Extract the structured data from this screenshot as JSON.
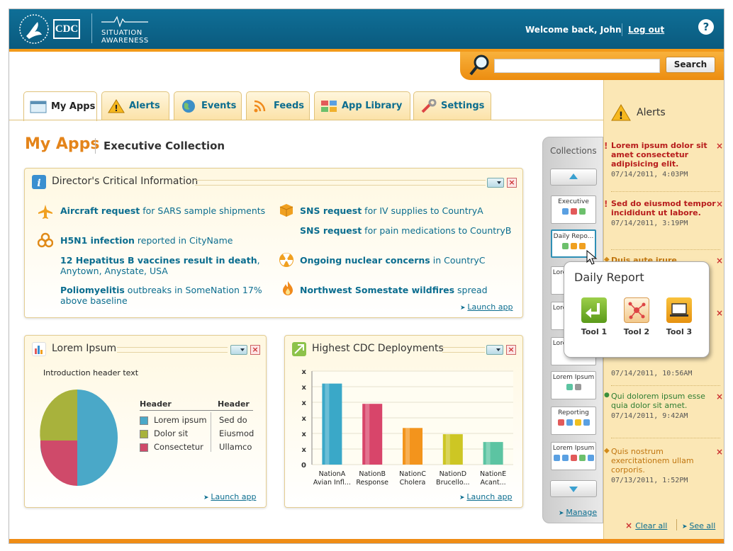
{
  "header": {
    "logo_text": "CDC",
    "app_name_line1": "SITUATION",
    "app_name_line2": "AWARENESS",
    "welcome": "Welcome back, John",
    "logout": "Log out",
    "help": "?"
  },
  "search": {
    "placeholder": "",
    "button": "Search"
  },
  "tabs": [
    {
      "label": "My Apps",
      "icon": "window-icon"
    },
    {
      "label": "Alerts",
      "icon": "warning-icon"
    },
    {
      "label": "Events",
      "icon": "globe-icon"
    },
    {
      "label": "Feeds",
      "icon": "rss-icon"
    },
    {
      "label": "App Library",
      "icon": "grid-icon"
    },
    {
      "label": "Settings",
      "icon": "wrench-icon"
    }
  ],
  "page": {
    "title": "My Apps",
    "subtitle": "Executive Collection"
  },
  "directors": {
    "title": "Director's Critical Information",
    "items": [
      {
        "bold": "Aircraft request",
        "rest": " for SARS sample shipments",
        "icon": "airplane-icon"
      },
      {
        "bold": "H5N1 infection",
        "rest": " reported in CityName",
        "icon": "biohazard-icon"
      },
      {
        "bold": "12 Hepatitus B vaccines result in death",
        "rest": ", Anytown, Anystate, USA"
      },
      {
        "bold": "Poliomyelitis",
        "rest": " outbreaks in SomeNation 17% above baseline"
      },
      {
        "bold": "SNS request",
        "rest": " for IV supplies to CountryA",
        "icon": "box-icon"
      },
      {
        "bold": "SNS request",
        "rest": " for pain medications to CountryB"
      },
      {
        "bold": "Ongoing nuclear concerns",
        "rest": " in CountryC",
        "icon": "radiation-icon"
      },
      {
        "bold": "Northwest Somestate wildfires",
        "rest": " spread",
        "icon": "fire-icon"
      }
    ],
    "launch": "Launch app"
  },
  "lorem": {
    "title": "Lorem Ipsum",
    "intro": "Introduction header text",
    "col1": "Header",
    "col2": "Header",
    "rows": [
      {
        "label": "Lorem ipsum",
        "value": "Sed do",
        "color": "#4aa8c8"
      },
      {
        "label": "Dolor sit",
        "value": "Eiusmod",
        "color": "#a8b23c"
      },
      {
        "label": "Consectetur",
        "value": "Ullamco",
        "color": "#cf4a6a"
      }
    ],
    "launch": "Launch app"
  },
  "deploy": {
    "title": "Highest CDC Deployments",
    "launch": "Launch app"
  },
  "chart_data": {
    "type": "bar",
    "categories": [
      "NationA Avian Infl...",
      "NationB Response",
      "NationC Cholera",
      "NationD Brucello...",
      "NationE Acant..."
    ],
    "cat_line1": [
      "NationA",
      "NationB",
      "NationC",
      "NationD",
      "NationE"
    ],
    "cat_line2": [
      "Avian Infl...",
      "Response",
      "Cholera",
      "Brucello...",
      "Acant..."
    ],
    "values": [
      5.2,
      3.9,
      2.35,
      1.95,
      1.45
    ],
    "ylim": [
      0,
      6
    ],
    "yticks": [
      "0",
      "x",
      "x",
      "x",
      "x",
      "x",
      "x"
    ],
    "colors": [
      "#3aa8c8",
      "#d8456a",
      "#f3941c",
      "#cdc624",
      "#5cc4a2"
    ],
    "title": "Highest CDC Deployments"
  },
  "collections": {
    "title": "Collections",
    "cards": [
      "Executive",
      "Daily Repo...",
      "Lorem Ipsum",
      "Lorem Ipsum",
      "Lorem Ipsum",
      "Lorem Ipsum",
      "Reporting",
      "Lorem Ipsum"
    ],
    "manage": "Manage"
  },
  "popup": {
    "title": "Daily Report",
    "tools": [
      "Tool 1",
      "Tool 2",
      "Tool 3"
    ]
  },
  "alerts": {
    "title": "Alerts",
    "items": [
      {
        "text": "Lorem ipsum dolor sit amet consectetur adipisicing elit.",
        "date": "07/14/2011, 4:03PM",
        "kind": "critical"
      },
      {
        "text": "Sed do eiusmod tempor incididunt ut labore.",
        "date": "07/14/2011, 3:19PM",
        "kind": "critical"
      },
      {
        "text": "Duis aute irure",
        "date": "",
        "kind": "warning"
      },
      {
        "text": "",
        "date": "07/14/2011, 10:56AM",
        "kind": "warning"
      },
      {
        "text": "Qui dolorem ipsum esse quia dolor sit amet.",
        "date": "07/14/2011, 9:42AM",
        "kind": "info"
      },
      {
        "text": "Quis nostrum exercitationem ullam corporis.",
        "date": "07/13/2011, 1:52PM",
        "kind": "warning"
      }
    ],
    "clear": "Clear all",
    "see": "See all"
  }
}
